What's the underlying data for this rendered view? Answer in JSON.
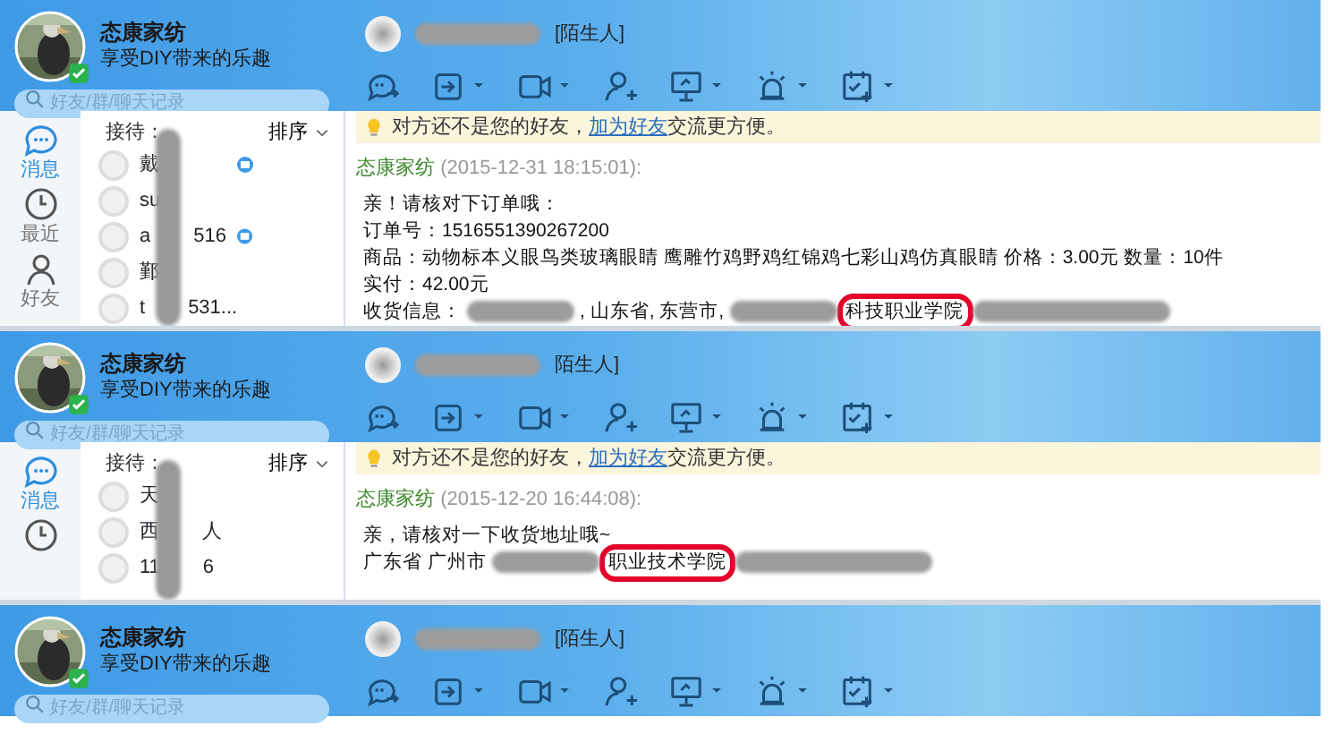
{
  "panels": [
    {
      "profile": {
        "name": "态康家纺",
        "motto": "享受DIY带来的乐趣",
        "online": true
      },
      "search": {
        "placeholder": "好友/群/聊天记录"
      },
      "contact": {
        "redacted": true,
        "tag": "[陌生人]"
      },
      "body": {
        "nav": [
          {
            "label": "消息",
            "kind": "chat",
            "selected": true
          },
          {
            "label": "最近",
            "kind": "clock",
            "selected": false
          },
          {
            "label": "好友",
            "kind": "person",
            "selected": false
          }
        ],
        "list": {
          "label": "接待：",
          "sort": "排序",
          "redacted": true,
          "contacts": [
            {
              "parts": [
                "戴"
              ],
              "badge": true
            },
            {
              "parts": [
                "su"
              ],
              "badge": false
            },
            {
              "parts": [
                "a",
                "516"
              ],
              "badge": true
            },
            {
              "parts": [
                "鄞"
              ],
              "badge": false
            },
            {
              "parts": [
                "t",
                "531..."
              ],
              "badge": false
            }
          ]
        },
        "notice": {
          "before": "对方还不是您的好友，",
          "link": "加为好友",
          "after": "交流更方便。"
        },
        "message": {
          "sender": "态康家纺",
          "time": "(2015-12-31 18:15:01):",
          "lines": [
            [
              {
                "kind": "text",
                "text": "亲！请核对下订单哦："
              }
            ],
            [
              {
                "kind": "text",
                "text": "订单号：1516551390267200"
              }
            ],
            [
              {
                "kind": "text",
                "text": "商品：动物标本义眼鸟类玻璃眼睛 鹰雕竹鸡野鸡红锦鸡七彩山鸡仿真眼睛 价格：3.00元 数量：10件"
              }
            ],
            [
              {
                "kind": "text",
                "text": "实付：42.00元"
              }
            ],
            [
              {
                "kind": "text",
                "text": "收货信息："
              },
              {
                "kind": "blur"
              },
              {
                "kind": "text",
                "text": ", 山东省, 东营市,"
              },
              {
                "kind": "blur"
              },
              {
                "kind": "text",
                "text": "科技职业学院",
                "circled": true
              },
              {
                "kind": "blur"
              }
            ]
          ]
        }
      }
    },
    {
      "profile": {
        "name": "态康家纺",
        "motto": "享受DIY带来的乐趣",
        "online": true
      },
      "search": {
        "placeholder": "好友/群/聊天记录"
      },
      "contact": {
        "redacted": true,
        "tag": "陌生人]"
      },
      "body": {
        "nav": [
          {
            "label": "消息",
            "kind": "chat",
            "selected": true
          },
          {
            "kind": "clock",
            "selected": false
          }
        ],
        "list": {
          "label": "接待：",
          "sort": "排序",
          "redacted": true,
          "contacts": [
            {
              "parts": [
                "天"
              ],
              "badge": false
            },
            {
              "parts": [
                "西",
                "人"
              ],
              "badge": false
            },
            {
              "parts": [
                "11",
                "6"
              ],
              "badge": false
            }
          ]
        },
        "notice": {
          "before": "对方还不是您的好友，",
          "link": "加为好友",
          "after": "交流更方便。"
        },
        "message": {
          "sender": "态康家纺",
          "time": "(2015-12-20 16:44:08):",
          "lines": [
            [
              {
                "kind": "text",
                "text": "亲，请核对一下收货地址哦~"
              }
            ],
            [
              {
                "kind": "text",
                "text": "广东省  广州市"
              },
              {
                "kind": "blur"
              },
              {
                "kind": "text",
                "text": "职业技术学院",
                "circled": true
              },
              {
                "kind": "blur"
              }
            ]
          ]
        }
      }
    },
    {
      "profile": {
        "name": "态康家纺",
        "motto": "享受DIY带来的乐趣",
        "online": true
      },
      "search": {
        "placeholder": "好友/群/聊天记录"
      },
      "contact": {
        "redacted": true,
        "tag": "[陌生人]"
      }
    }
  ]
}
